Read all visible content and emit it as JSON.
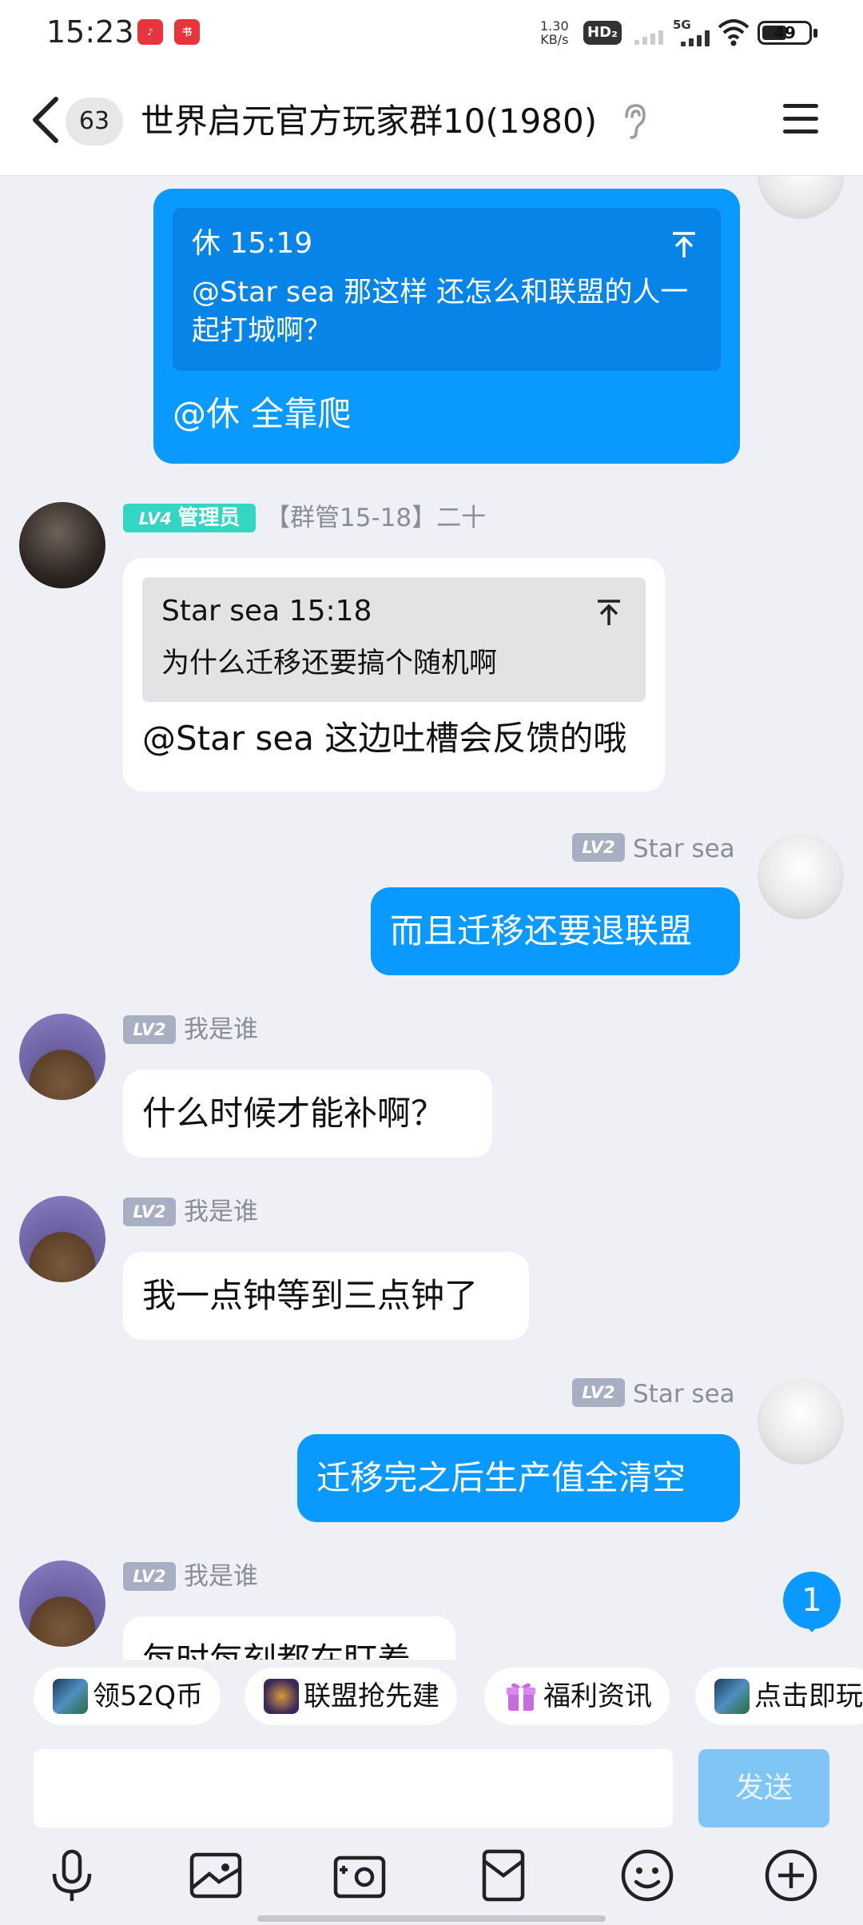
{
  "status_bar": {
    "time": "15:23",
    "net_speed_value": "1.30",
    "net_speed_unit": "KB/s",
    "hd_label": "HD₂",
    "network": "5G",
    "battery": "49"
  },
  "header": {
    "unread_count": "63",
    "title": "世界启元官方玩家群10(1980)"
  },
  "messages": {
    "m1": {
      "quote_author": "休 15:19",
      "quote_text": "@Star sea 那这样 还怎么和联盟的人一起打城啊？",
      "text": "@休 全靠爬"
    },
    "m2": {
      "level": "LV4",
      "role": "管理员",
      "name": "【群管15-18】二十",
      "quote_author": "Star sea 15:18",
      "quote_text": "为什么迁移还要搞个随机啊",
      "text": "@Star sea 这边吐槽会反馈的哦"
    },
    "m3": {
      "level": "LV2",
      "name": "Star sea",
      "text": "而且迁移还要退联盟"
    },
    "m4": {
      "level": "LV2",
      "name": "我是谁",
      "text": "什么时候才能补啊？"
    },
    "m5": {
      "level": "LV2",
      "name": "我是谁",
      "text": "我一点钟等到三点钟了"
    },
    "m6": {
      "level": "LV2",
      "name": "Star sea",
      "text": "迁移完之后生产值全清空"
    },
    "m7": {
      "level": "LV2",
      "name": "我是谁",
      "text": "每时每刻都在盯着"
    }
  },
  "new_message_badge": "1",
  "quick_chips": [
    {
      "label": "领52Q币",
      "icon": "game-icon"
    },
    {
      "label": "联盟抢先建",
      "icon": "game-icon"
    },
    {
      "label": "福利资讯",
      "icon": "gift-icon"
    },
    {
      "label": "点击即玩",
      "icon": "game-icon"
    }
  ],
  "composer": {
    "send_label": "发送",
    "placeholder": ""
  },
  "toolbar_icons": [
    "mic-icon",
    "image-icon",
    "camera-icon",
    "red-packet-icon",
    "emoji-icon",
    "plus-icon"
  ],
  "colors": {
    "accent": "#0a99ff",
    "admin_badge": "#33d6c2",
    "send_disabled": "#7fc6f7"
  }
}
